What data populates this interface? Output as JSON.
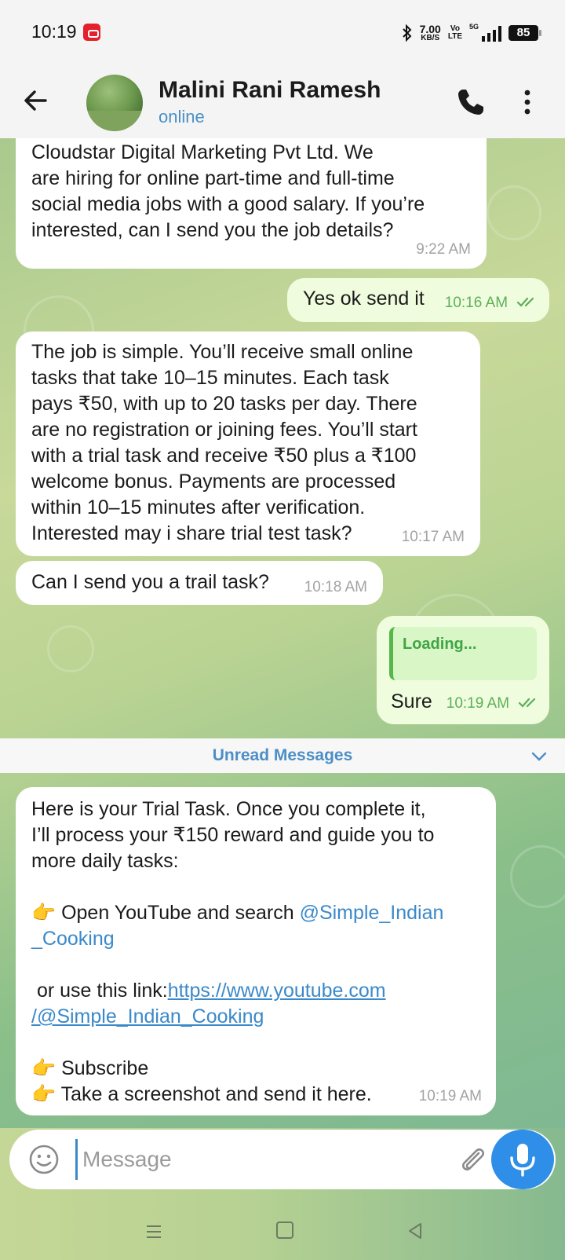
{
  "status_bar": {
    "time": "10:19",
    "net_speed_value": "7.00",
    "net_speed_unit": "KB/S",
    "volte_top": "Vo",
    "volte_bottom": "LTE",
    "network": "5G",
    "battery": "85"
  },
  "header": {
    "contact_name": "Malini Rani Ramesh",
    "contact_status": "online"
  },
  "messages": [
    {
      "direction": "incoming",
      "text": "Cloudstar Digital Marketing Pvt Ltd. We\nare hiring for online part-time and full-time\nsocial media jobs with a good salary. If you’re\ninterested, can I send you the job details?",
      "time": "9:22 AM"
    },
    {
      "direction": "outgoing",
      "text": "Yes ok send it",
      "time": "10:16 AM",
      "read": true
    },
    {
      "direction": "incoming",
      "text": "The job is simple. You’ll receive small online\ntasks that take 10–15 minutes. Each task\npays ₹50, with up to 20 tasks per day. There\nare no registration or joining fees. You’ll start\nwith a trial task and receive ₹50 plus a ₹100\nwelcome bonus. Payments are processed\nwithin 10–15 minutes after verification.\nInterested may i share trial test task?",
      "time": "10:17 AM"
    },
    {
      "direction": "incoming",
      "text": "Can I send you a trail task?",
      "time": "10:18 AM"
    },
    {
      "direction": "outgoing",
      "reply_preview": "Loading...",
      "text": "Sure",
      "time": "10:19 AM",
      "read": true
    },
    {
      "direction": "incoming",
      "intro": "Here is your Trial Task. Once you complete it,\nI’ll process your ₹150 reward and guide you to\nmore daily tasks:",
      "step1_prefix": "👉 Open YouTube and search ",
      "step1_handle": "@Simple_Indian\n_Cooking",
      "link_prefix": " or use this link:",
      "link": "https://www.youtube.com\n/@Simple_Indian_Cooking",
      "step2": "👉 Subscribe",
      "step3": "👉 Take a screenshot and send it here.",
      "time": "10:19 AM"
    }
  ],
  "unread_divider": "Unread Messages",
  "composer": {
    "placeholder": "Message"
  },
  "icons": {
    "back": "arrow-left-icon",
    "call": "phone-icon",
    "menu": "more-vertical-icon",
    "emoji": "smiley-icon",
    "attach": "paperclip-icon",
    "mic": "microphone-icon"
  },
  "colors": {
    "accent": "#2f8ee7",
    "outgoing_bubble": "#effdde",
    "read_ticks": "#5eae5a",
    "link": "#3b89c9"
  }
}
